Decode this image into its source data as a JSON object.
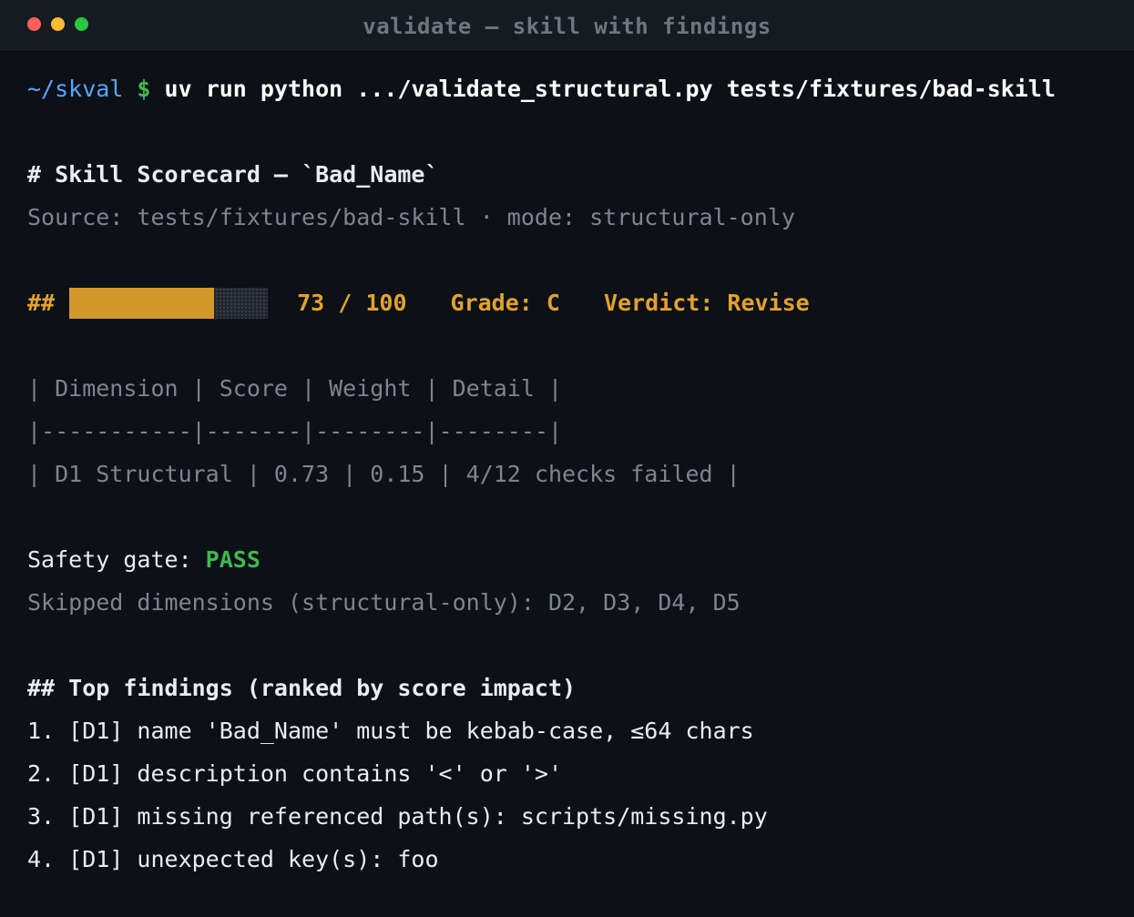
{
  "window": {
    "title": "validate — skill with findings"
  },
  "prompt": {
    "path": "~/skval",
    "symbol": "$",
    "command": "uv run python .../validate_structural.py tests/fixtures/bad-skill"
  },
  "scorecard": {
    "heading": "# Skill Scorecard — `Bad_Name`",
    "source": "Source: tests/fixtures/bad-skill · mode: structural-only",
    "score_prefix": "##",
    "score_fraction": 0.73,
    "score": "73 / 100",
    "grade": "Grade: C",
    "verdict": "Verdict: Revise"
  },
  "table": {
    "header": "| Dimension | Score | Weight | Detail |",
    "separator": "|-----------|-------|--------|--------|",
    "rows": [
      "| D1 Structural | 0.73 | 0.15 | 4/12 checks failed |"
    ]
  },
  "safety": {
    "label": "Safety gate: ",
    "status": "PASS"
  },
  "skipped": "Skipped dimensions (structural-only): D2, D3, D4, D5",
  "findings": {
    "heading": "## Top findings (ranked by score impact)",
    "items": [
      "1. [D1] name 'Bad_Name' must be kebab-case, ≤64 chars",
      "2. [D1] description contains '<' or '>'",
      "3. [D1] missing referenced path(s): scripts/missing.py",
      "4. [D1] unexpected key(s): foo"
    ]
  },
  "colors": {
    "background": "#0d1117",
    "amber": "#e3a22a",
    "green": "#3fb950",
    "path_blue": "#58a6ff"
  }
}
